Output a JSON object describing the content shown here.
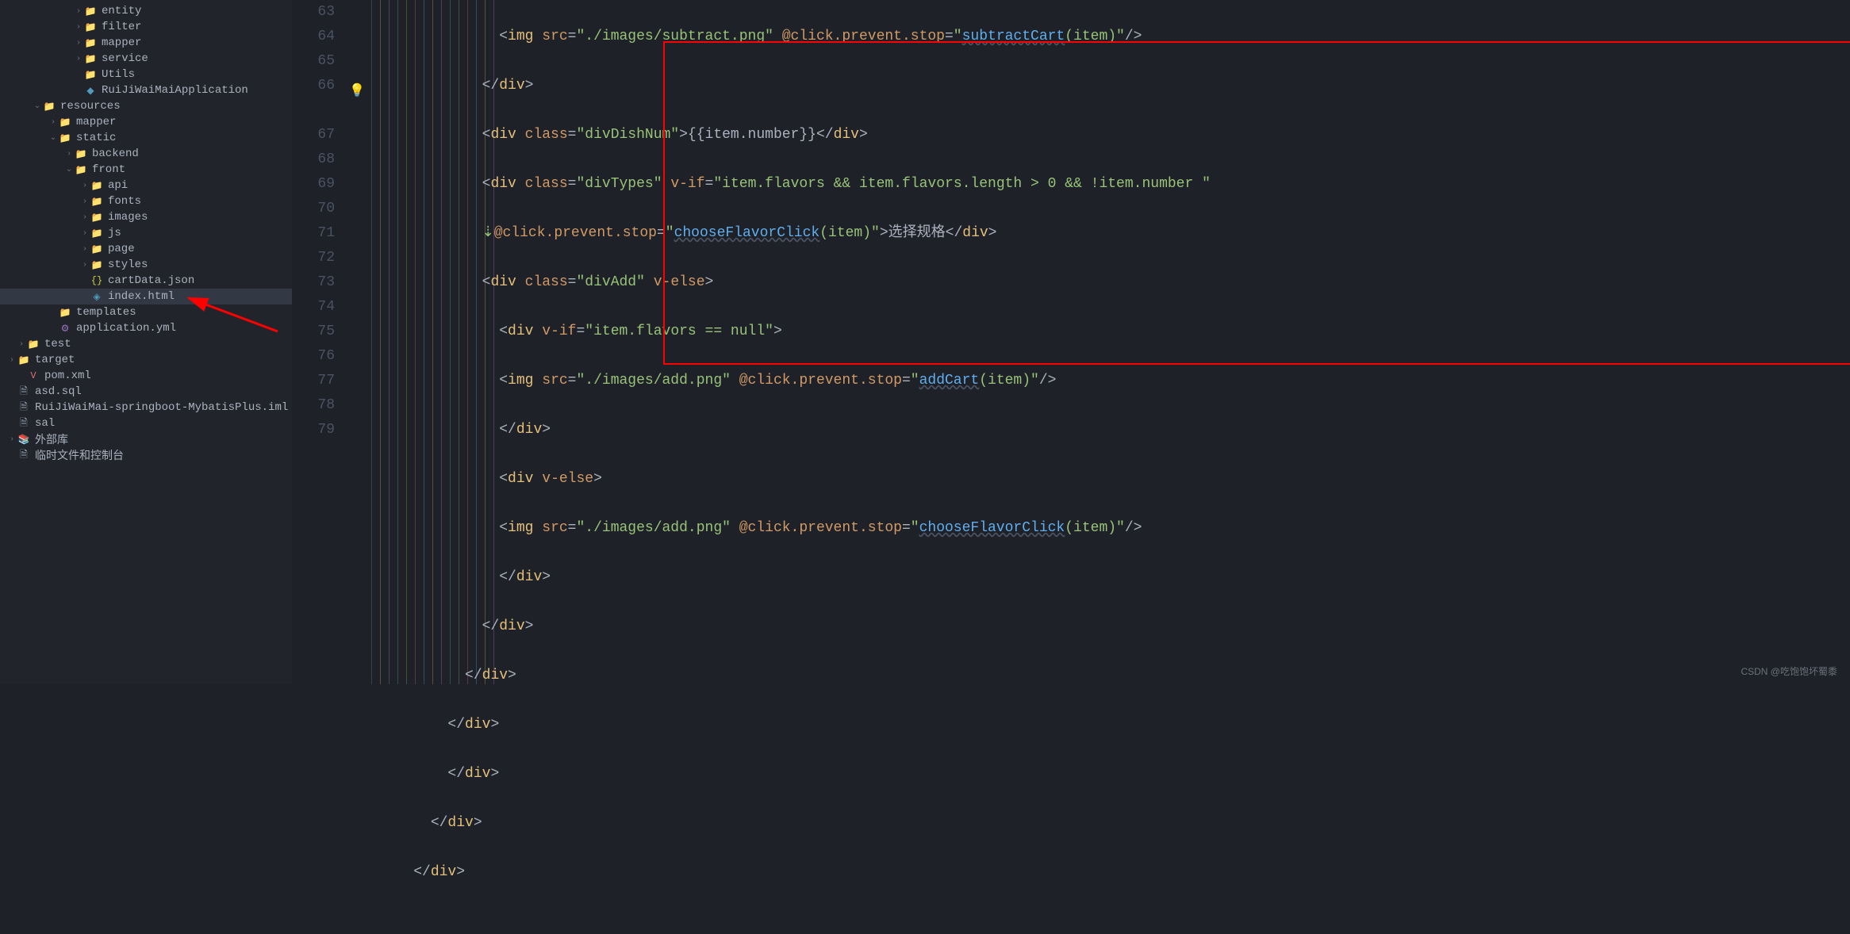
{
  "sidebar": {
    "items": [
      {
        "indent": 88,
        "chev": "›",
        "icon": "📁",
        "iconClass": "folder-teal",
        "label": "entity"
      },
      {
        "indent": 88,
        "chev": "›",
        "icon": "📁",
        "iconClass": "folder-teal",
        "label": "filter"
      },
      {
        "indent": 88,
        "chev": "›",
        "icon": "📁",
        "iconClass": "folder-teal",
        "label": "mapper"
      },
      {
        "indent": 88,
        "chev": "›",
        "icon": "📁",
        "iconClass": "folder-teal",
        "label": "service"
      },
      {
        "indent": 88,
        "chev": "",
        "icon": "📁",
        "iconClass": "folder-teal",
        "label": "Utils"
      },
      {
        "indent": 88,
        "chev": "",
        "icon": "◆",
        "iconClass": "folder-blue",
        "label": "RuiJiWaiMaiApplication"
      },
      {
        "indent": 36,
        "chev": "⌄",
        "icon": "📁",
        "iconClass": "folder-purple",
        "label": "resources"
      },
      {
        "indent": 56,
        "chev": "›",
        "icon": "📁",
        "iconClass": "folder-yellow",
        "label": "mapper"
      },
      {
        "indent": 56,
        "chev": "⌄",
        "icon": "📁",
        "iconClass": "folder-dblue",
        "label": "static"
      },
      {
        "indent": 76,
        "chev": "›",
        "icon": "📁",
        "iconClass": "folder-yellow",
        "label": "backend"
      },
      {
        "indent": 76,
        "chev": "⌄",
        "icon": "📁",
        "iconClass": "folder-dblue",
        "label": "front"
      },
      {
        "indent": 96,
        "chev": "›",
        "icon": "📁",
        "iconClass": "folder-yellow",
        "label": "api"
      },
      {
        "indent": 96,
        "chev": "›",
        "icon": "📁",
        "iconClass": "folder-teal",
        "label": "fonts"
      },
      {
        "indent": 96,
        "chev": "›",
        "icon": "📁",
        "iconClass": "folder-teal",
        "label": "images"
      },
      {
        "indent": 96,
        "chev": "›",
        "icon": "📁",
        "iconClass": "folder-yellow",
        "label": "js"
      },
      {
        "indent": 96,
        "chev": "›",
        "icon": "📁",
        "iconClass": "folder-yellow",
        "label": "page"
      },
      {
        "indent": 96,
        "chev": "›",
        "icon": "📁",
        "iconClass": "folder-yellow",
        "label": "styles"
      },
      {
        "indent": 96,
        "chev": "",
        "icon": "{}",
        "iconClass": "file-json",
        "label": "cartData.json"
      },
      {
        "indent": 96,
        "chev": "",
        "icon": "◈",
        "iconClass": "file-html",
        "label": "index.html",
        "selected": true
      },
      {
        "indent": 56,
        "chev": "",
        "icon": "📁",
        "iconClass": "folder-yellow",
        "label": "templates"
      },
      {
        "indent": 56,
        "chev": "",
        "icon": "⚙",
        "iconClass": "file-yml",
        "label": "application.yml"
      },
      {
        "indent": 16,
        "chev": "›",
        "icon": "📁",
        "iconClass": "folder-teal",
        "label": "test"
      },
      {
        "indent": 4,
        "chev": "›",
        "icon": "📁",
        "iconClass": "folder-teal",
        "label": "target"
      },
      {
        "indent": 16,
        "chev": "",
        "icon": "V",
        "iconClass": "file-red",
        "label": "pom.xml"
      },
      {
        "indent": 4,
        "chev": "",
        "icon": "🗎",
        "iconClass": "file-db",
        "label": "asd.sql"
      },
      {
        "indent": 4,
        "chev": "",
        "icon": "🗎",
        "iconClass": "file-iml",
        "label": "RuiJiWaiMai-springboot-MybatisPlus.iml"
      },
      {
        "indent": 4,
        "chev": "",
        "icon": "🗎",
        "iconClass": "file-generic",
        "label": "sal"
      },
      {
        "indent": 4,
        "chev": "›",
        "icon": "📚",
        "iconClass": "file-generic",
        "label": "外部库"
      },
      {
        "indent": 4,
        "chev": "",
        "icon": "🗎",
        "iconClass": "file-generic",
        "label": "临时文件和控制台"
      }
    ]
  },
  "gutter": [
    "63",
    "64",
    "65",
    "66",
    "",
    "67",
    "68",
    "69",
    "70",
    "71",
    "72",
    "73",
    "74",
    "75",
    "76",
    "77",
    "78",
    "79"
  ],
  "watermark": "CSDN @吃饱饱坏蜀黍",
  "code": {
    "l63": {
      "pad": "              ",
      "t1": "img",
      "a1": "src",
      "v1": "\"./images/subtract.png\"",
      "a2": "@click.prevent.stop",
      "v2a": "\"",
      "fn": "subtractCart",
      "v2b": "(item)\""
    },
    "l64": {
      "pad": "            ",
      "t1": "div"
    },
    "l65": {
      "pad": "            ",
      "t1": "div",
      "a1": "class",
      "v1": "\"divDishNum\"",
      "m": "{{item.number}}"
    },
    "l66": {
      "pad": "            ",
      "t1": "div",
      "a1": "class",
      "v1": "\"divTypes\"",
      "a2": "v-if",
      "v2": "\"item.flavors",
      "rest": " && item.flavors.length > 0 && !item.number \""
    },
    "l66b": {
      "pad": "            ",
      "a1": "@click.prevent.stop",
      "v1a": "\"",
      "fn": "chooseFlavorClick",
      "v1b": "(item)\"",
      "txt": "选择规格",
      "t2": "div"
    },
    "l67": {
      "pad": "            ",
      "t1": "div",
      "a1": "class",
      "v1": "\"divAdd\"",
      "a2": "v-else"
    },
    "l68": {
      "pad": "              ",
      "t1": "div",
      "a1": "v-if",
      "v1": "\"item.flavors == null\""
    },
    "l69": {
      "pad": "              ",
      "t1": "img",
      "a1": "src",
      "v1": "\"./images/add.png\"",
      "a2": "@click.prevent.stop",
      "v2a": "\"",
      "fn": "addCart",
      "v2b": "(item)\""
    },
    "l70": {
      "pad": "              ",
      "t1": "div"
    },
    "l71": {
      "pad": "              ",
      "t1": "div",
      "a1": "v-else"
    },
    "l72": {
      "pad": "              ",
      "t1": "img",
      "a1": "src",
      "v1": "\"./images/add.png\"",
      "a2": "@click.prevent.stop",
      "v2a": "\"",
      "fn": "chooseFlavorClick",
      "v2b": "(item)\""
    },
    "l73": {
      "pad": "              ",
      "t1": "div"
    },
    "l74": {
      "pad": "            ",
      "t1": "div"
    },
    "l75": {
      "pad": "          ",
      "t1": "div"
    },
    "l76": {
      "pad": "        ",
      "t1": "div"
    },
    "l77": {
      "pad": "        ",
      "t1": "div"
    },
    "l78": {
      "pad": "      ",
      "t1": "div"
    },
    "l79": {
      "pad": "    ",
      "t1": "div"
    }
  }
}
